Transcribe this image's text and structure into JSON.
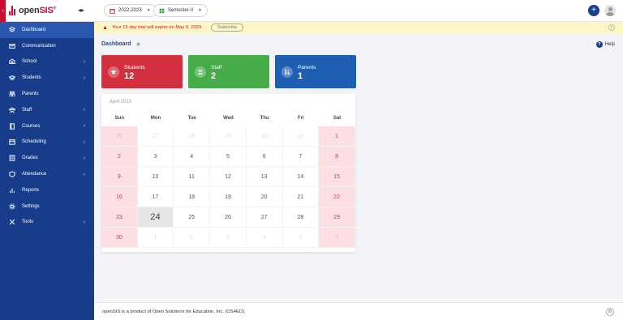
{
  "brand": {
    "name_prefix": "open",
    "name_suffix": "SIS",
    "reg": "®"
  },
  "topbar": {
    "year_select": "2022-2023",
    "semester_select": "Semester-II"
  },
  "banner": {
    "message": "Your 15 day trial will expire on May 9, 2023.",
    "subscribe_label": "Subscribe"
  },
  "page": {
    "title": "Dashboard",
    "help_label": "Help"
  },
  "sidebar": {
    "items": [
      {
        "label": "Dashboard",
        "icon": "layers-icon",
        "active": true,
        "has_children": false
      },
      {
        "label": "Communication",
        "icon": "message-icon",
        "active": false,
        "has_children": false
      },
      {
        "label": "School",
        "icon": "school-icon",
        "active": false,
        "has_children": true
      },
      {
        "label": "Students",
        "icon": "graduation-cap-icon",
        "active": false,
        "has_children": true
      },
      {
        "label": "Parents",
        "icon": "parents-icon",
        "active": false,
        "has_children": false
      },
      {
        "label": "Staff",
        "icon": "staff-icon",
        "active": false,
        "has_children": true
      },
      {
        "label": "Courses",
        "icon": "book-icon",
        "active": false,
        "has_children": true
      },
      {
        "label": "Scheduling",
        "icon": "calendar-icon",
        "active": false,
        "has_children": true
      },
      {
        "label": "Grades",
        "icon": "grades-icon",
        "active": false,
        "has_children": true
      },
      {
        "label": "Attendance",
        "icon": "shield-icon",
        "active": false,
        "has_children": true
      },
      {
        "label": "Reports",
        "icon": "chart-icon",
        "active": false,
        "has_children": false
      },
      {
        "label": "Settings",
        "icon": "gear-icon",
        "active": false,
        "has_children": false
      },
      {
        "label": "Tools",
        "icon": "tools-icon",
        "active": false,
        "has_children": true
      }
    ]
  },
  "cards": [
    {
      "label": "Students",
      "value": "12",
      "color": "#d32f3f",
      "icon": "graduation-cap-icon"
    },
    {
      "label": "Staff",
      "value": "2",
      "color": "#46ac4a",
      "icon": "staff-icon"
    },
    {
      "label": "Parents",
      "value": "1",
      "color": "#1e5fb3",
      "icon": "parents-icon"
    }
  ],
  "calendar": {
    "title": "April 2023",
    "days": [
      "Sun",
      "Mon",
      "Tue",
      "Wed",
      "Thu",
      "Fri",
      "Sat"
    ],
    "weeks": [
      [
        {
          "d": "26",
          "m": true
        },
        {
          "d": "27",
          "m": true
        },
        {
          "d": "28",
          "m": true
        },
        {
          "d": "29",
          "m": true
        },
        {
          "d": "30",
          "m": true
        },
        {
          "d": "31",
          "m": true
        },
        {
          "d": "1"
        }
      ],
      [
        {
          "d": "2"
        },
        {
          "d": "3"
        },
        {
          "d": "4"
        },
        {
          "d": "5"
        },
        {
          "d": "6"
        },
        {
          "d": "7"
        },
        {
          "d": "8"
        }
      ],
      [
        {
          "d": "9"
        },
        {
          "d": "10"
        },
        {
          "d": "11"
        },
        {
          "d": "12"
        },
        {
          "d": "13"
        },
        {
          "d": "14"
        },
        {
          "d": "15"
        }
      ],
      [
        {
          "d": "16"
        },
        {
          "d": "17"
        },
        {
          "d": "18"
        },
        {
          "d": "19"
        },
        {
          "d": "20"
        },
        {
          "d": "21"
        },
        {
          "d": "22"
        }
      ],
      [
        {
          "d": "23"
        },
        {
          "d": "24",
          "today": true
        },
        {
          "d": "25"
        },
        {
          "d": "26"
        },
        {
          "d": "27"
        },
        {
          "d": "28"
        },
        {
          "d": "29"
        }
      ],
      [
        {
          "d": "30"
        },
        {
          "d": "1",
          "m": true
        },
        {
          "d": "2",
          "m": true
        },
        {
          "d": "3",
          "m": true
        },
        {
          "d": "4",
          "m": true
        },
        {
          "d": "5",
          "m": true
        },
        {
          "d": "6",
          "m": true
        }
      ]
    ]
  },
  "footer": {
    "text": "openSIS is a product of Open Solutions for Education, Inc. (OS4ED)."
  },
  "colors": {
    "sidebar": "#173d8a",
    "sidebar_active": "#2c57b0",
    "accent_red": "#c8102e",
    "weekend": "#fbdfe3"
  }
}
